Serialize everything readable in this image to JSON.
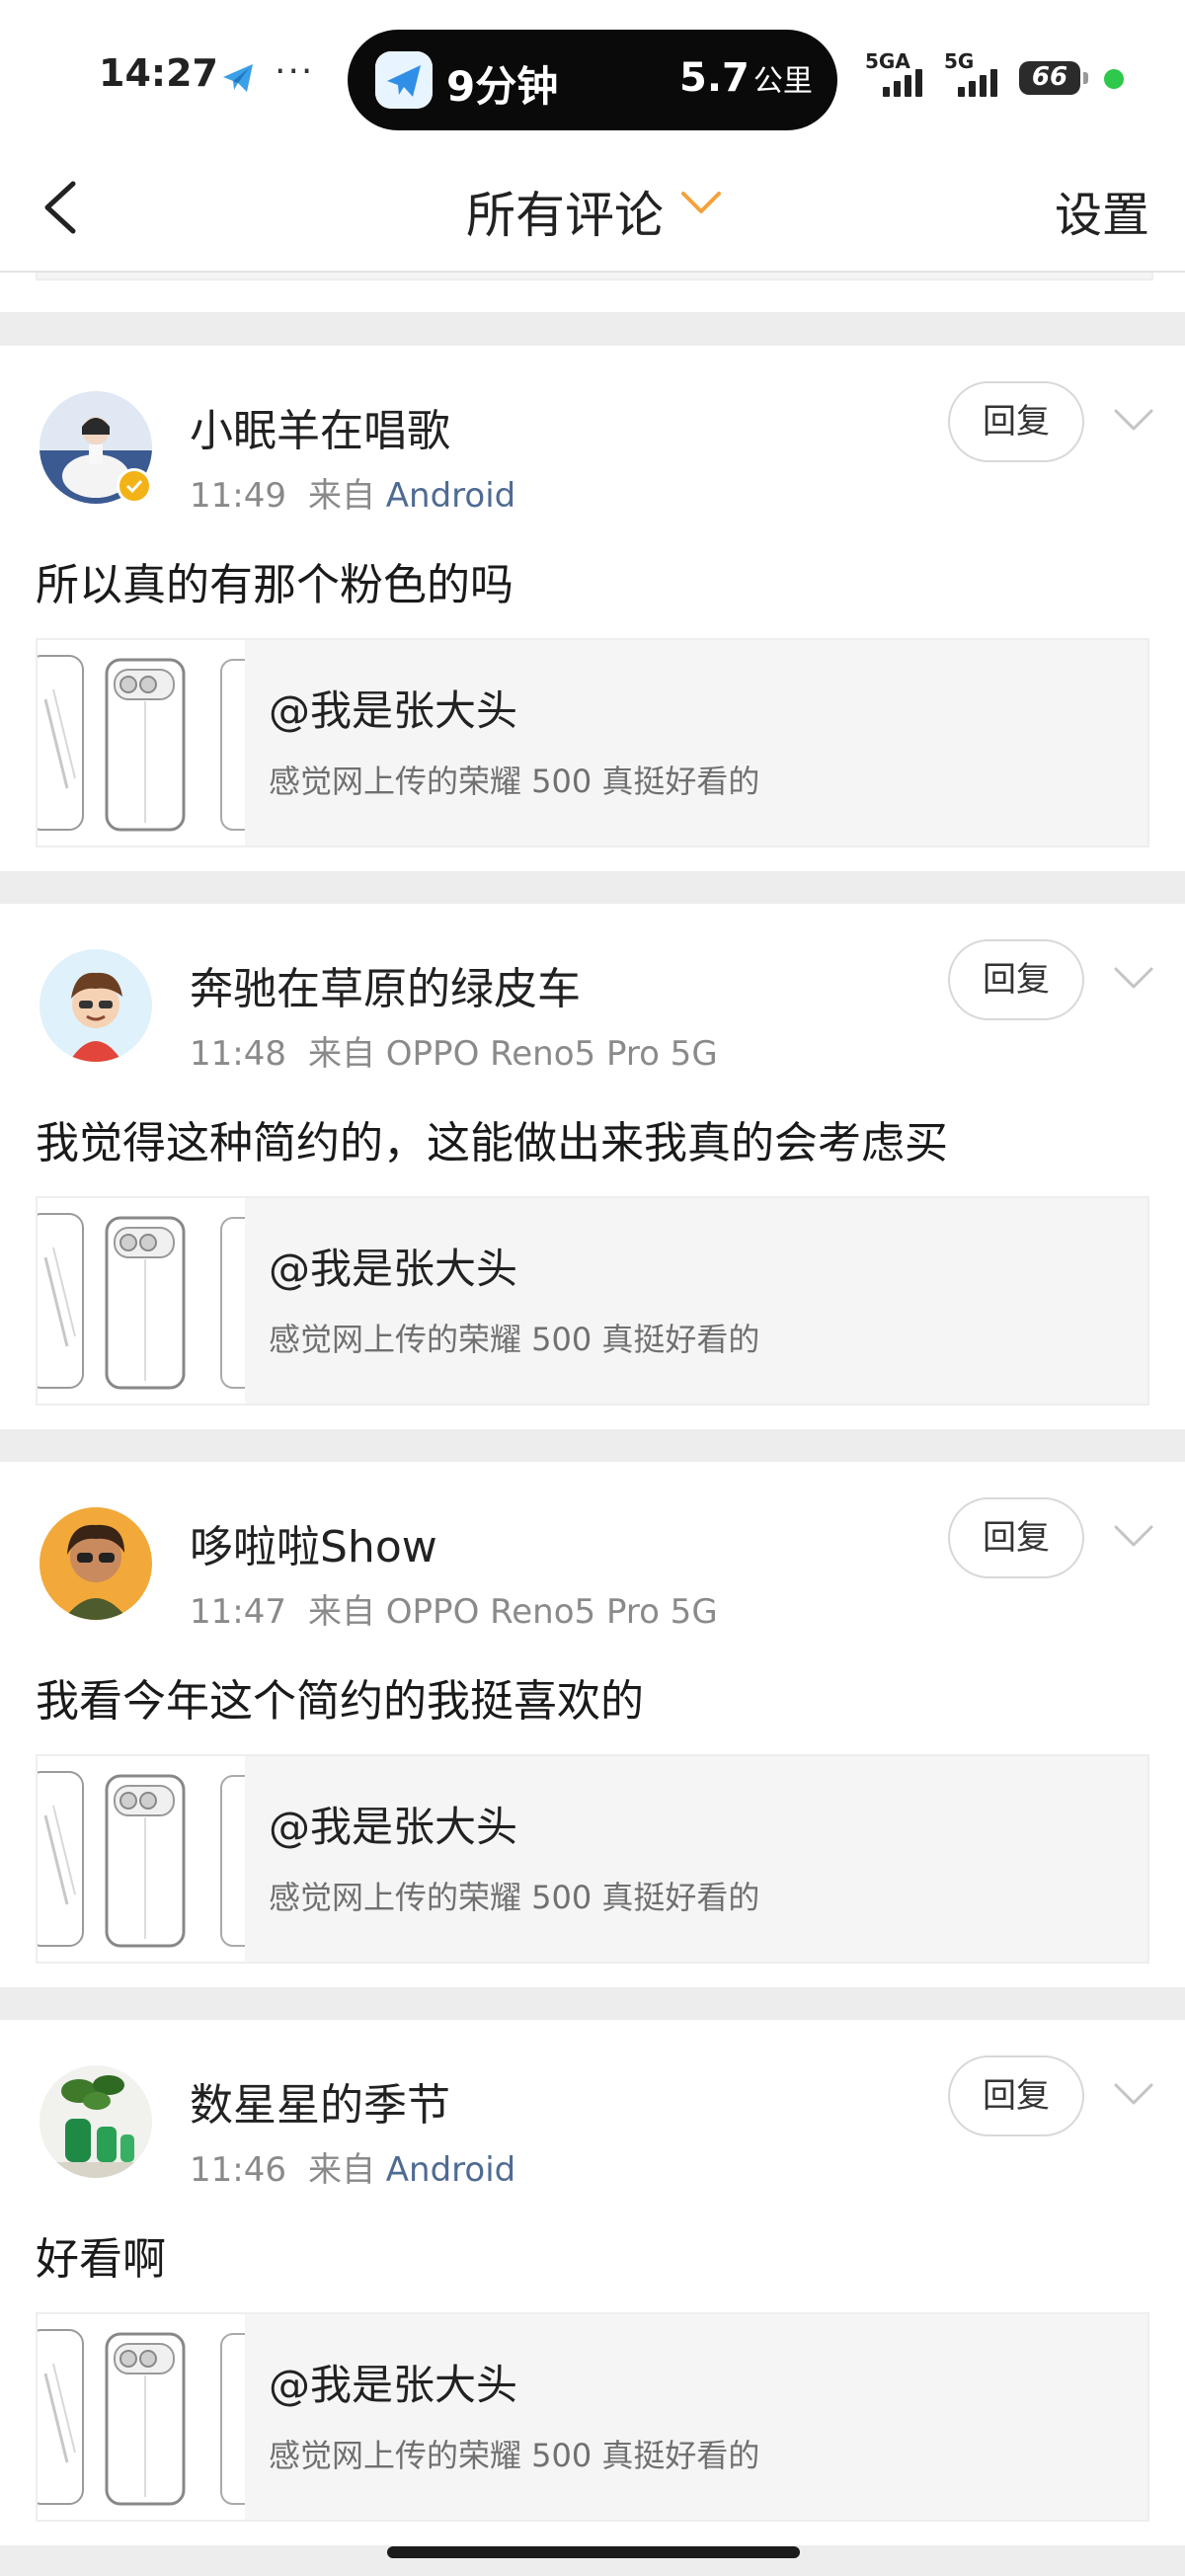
{
  "status_bar": {
    "time": "14:27",
    "dots": "···",
    "island_minutes": "9分钟",
    "island_distance_num": "5.7",
    "island_distance_unit": "公里",
    "net1": "5GA",
    "net2": "5G",
    "battery": "66"
  },
  "nav": {
    "title": "所有评论",
    "settings": "设置"
  },
  "comments": [
    {
      "username": "小眠羊在唱歌",
      "time": "11:49",
      "from": "来自",
      "source": "Android",
      "verified": true,
      "text": "所以真的有那个粉色的吗",
      "reply": "回复",
      "quote_mention": "@我是张大头",
      "quote_text": "感觉网上传的荣耀 500 真挺好看的"
    },
    {
      "username": "奔驰在草原的绿皮车",
      "time": "11:48",
      "from": "来自",
      "source": "OPPO Reno5 Pro 5G",
      "verified": false,
      "text": "我觉得这种简约的，这能做出来我真的会考虑买",
      "reply": "回复",
      "quote_mention": "@我是张大头",
      "quote_text": "感觉网上传的荣耀 500 真挺好看的"
    },
    {
      "username": "哆啦啦Show",
      "time": "11:47",
      "from": "来自",
      "source": "OPPO Reno5 Pro 5G",
      "verified": false,
      "text": "我看今年这个简约的我挺喜欢的",
      "reply": "回复",
      "quote_mention": "@我是张大头",
      "quote_text": "感觉网上传的荣耀 500 真挺好看的"
    },
    {
      "username": "数星星的季节",
      "time": "11:46",
      "from": "来自",
      "source": "Android",
      "verified": false,
      "text": "好看啊",
      "reply": "回复",
      "quote_mention": "@我是张大头",
      "quote_text": "感觉网上传的荣耀 500 真挺好看的"
    }
  ],
  "colors": {
    "accent_orange": "#f5a13a",
    "link_blue": "#4f6b93",
    "verified_gold": "#f3b316"
  }
}
